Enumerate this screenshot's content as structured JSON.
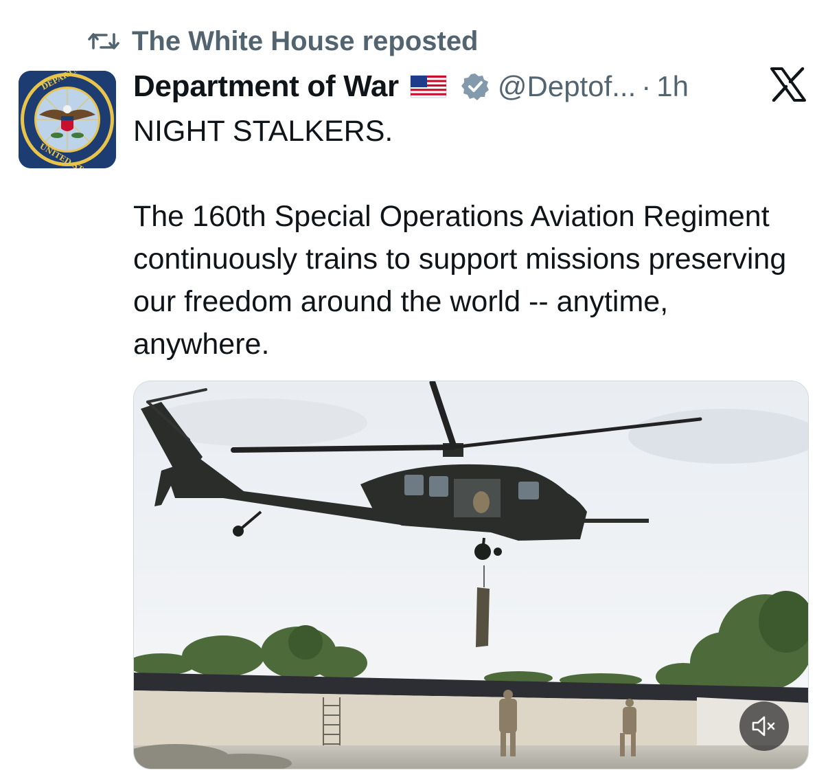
{
  "repost": {
    "icon": "repost-icon",
    "text": "The White House reposted"
  },
  "author": {
    "avatar": "department-seal-avatar",
    "display_name": "Department of War",
    "flag_icon": "us-flag-emoji",
    "verified_icon": "verified-badge-icon",
    "handle": "@Deptof...",
    "separator": "·",
    "time": "1h"
  },
  "platform_icon": "x-logo-icon",
  "tweet": {
    "line1": "NIGHT STALKERS.",
    "line2": "The 160th Special Operations Aviation Regiment continuously trains to support missions preserving our freedom around the world -- anytime, anywhere."
  },
  "media": {
    "type": "video",
    "description_icon": "helicopter-video",
    "mute_icon": "muted-speaker-icon"
  },
  "colors": {
    "text_primary": "#0f1419",
    "text_secondary": "#536471",
    "verified_badge": "#829aab",
    "border": "#cfd9de"
  }
}
